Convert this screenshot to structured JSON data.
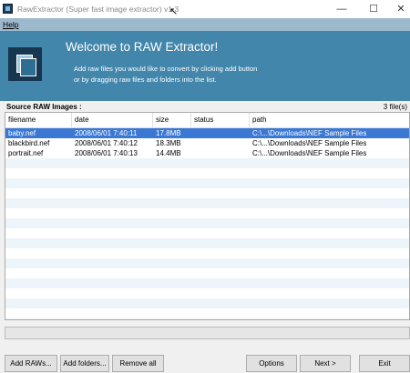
{
  "window": {
    "title": "RawExtractor (Super fast image extractor) v1.3",
    "controls": {
      "minimize": "—",
      "maximize": "☐",
      "close": "✕"
    }
  },
  "menu": {
    "help": "Help"
  },
  "banner": {
    "title": "Welcome to RAW Extractor!",
    "line1": "Add raw files you would like to convert by clicking add button",
    "line2": "or by dragging raw files and folders into the list."
  },
  "source": {
    "title": "Source RAW Images :",
    "file_count": "3 file(s)",
    "columns": [
      "filename",
      "date",
      "size",
      "status",
      "path"
    ],
    "rows": [
      {
        "filename": "baby.nef",
        "date": "2008/06/01  7:40:11",
        "size": "17.8MB",
        "status": "",
        "path": "C:\\...\\Downloads\\NEF Sample Files",
        "selected": true
      },
      {
        "filename": "blackbird.nef",
        "date": "2008/06/01  7:40:12",
        "size": "18.3MB",
        "status": "",
        "path": "C:\\...\\Downloads\\NEF Sample Files",
        "selected": false
      },
      {
        "filename": "portrait.nef",
        "date": "2008/06/01  7:40:13",
        "size": "14.4MB",
        "status": "",
        "path": "C:\\...\\Downloads\\NEF Sample Files",
        "selected": false
      }
    ]
  },
  "buttons": {
    "add_raws": "Add RAWs...",
    "add_folders": "Add folders...",
    "remove_all": "Remove all",
    "options": "Options",
    "next": "Next >",
    "exit": "Exit"
  },
  "colors": {
    "banner": "#4286ab",
    "menubar": "#9cb9cd",
    "selection": "#3a78d4"
  }
}
